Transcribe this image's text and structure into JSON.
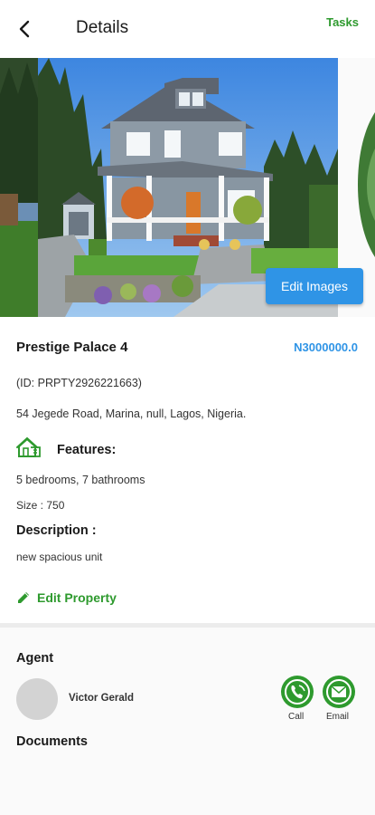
{
  "header": {
    "back_icon": "arrow-left-icon",
    "title": "Details",
    "action_label": "Tasks"
  },
  "gallery": {
    "edit_images_label": "Edit Images"
  },
  "property": {
    "name": "Prestige Palace 4",
    "price": "N3000000.0",
    "id_text": "(ID: PRPTY2926221663)",
    "address": "54 Jegede Road, Marina, null, Lagos, Nigeria.",
    "features_icon": "house-icon",
    "features_label": "Features:",
    "rooms": "5 bedrooms, 7 bathrooms",
    "size": "Size : 750",
    "description_label": "Description :",
    "description": "new spacious unit",
    "edit_label": "Edit Property"
  },
  "agent": {
    "section_label": "Agent",
    "name": "Victor Gerald",
    "call_label": "Call",
    "email_label": "Email"
  },
  "documents": {
    "section_label": "Documents"
  },
  "colors": {
    "accent_green": "#2e9a2e",
    "accent_blue": "#2f94e6"
  }
}
